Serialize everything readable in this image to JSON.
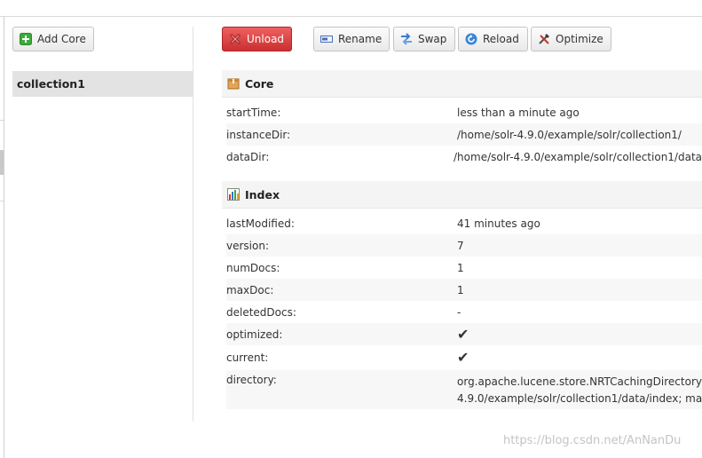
{
  "sidebar": {
    "add_core_label": "Add Core",
    "cores": [
      "collection1"
    ]
  },
  "toolbar": {
    "unload_label": "Unload",
    "rename_label": "Rename",
    "swap_label": "Swap",
    "reload_label": "Reload",
    "optimize_label": "Optimize"
  },
  "core_section": {
    "title": "Core",
    "rows": [
      {
        "key": "startTime:",
        "value": "less than a minute ago"
      },
      {
        "key": "instanceDir:",
        "value": "/home/solr-4.9.0/example/solr/collection1/"
      },
      {
        "key": "dataDir:",
        "value": "/home/solr-4.9.0/example/solr/collection1/data"
      }
    ]
  },
  "index_section": {
    "title": "Index",
    "rows": [
      {
        "key": "lastModified:",
        "value": "41 minutes ago"
      },
      {
        "key": "version:",
        "value": "7"
      },
      {
        "key": "numDocs:",
        "value": "1"
      },
      {
        "key": "maxDoc:",
        "value": "1"
      },
      {
        "key": "deletedDocs:",
        "value": "-"
      },
      {
        "key": "optimized:",
        "value": "✔"
      },
      {
        "key": "current:",
        "value": "✔"
      },
      {
        "key": "directory:",
        "value_line1": "org.apache.lucene.store.NRTCachingDirectory",
        "value_line2": "4.9.0/example/solr/collection1/data/index; ma"
      }
    ]
  },
  "watermark": "https://blog.csdn.net/AnNanDu",
  "colors": {
    "unload": "#d83c3c",
    "check": "#2aa52a",
    "add": "#3bab3b"
  },
  "icons": {
    "add": "plus-square-icon",
    "unload": "x-icon",
    "rename": "rename-icon",
    "swap": "swap-icon",
    "reload": "reload-icon",
    "optimize": "tools-icon",
    "core": "box-icon",
    "index": "bar-chart-icon"
  }
}
